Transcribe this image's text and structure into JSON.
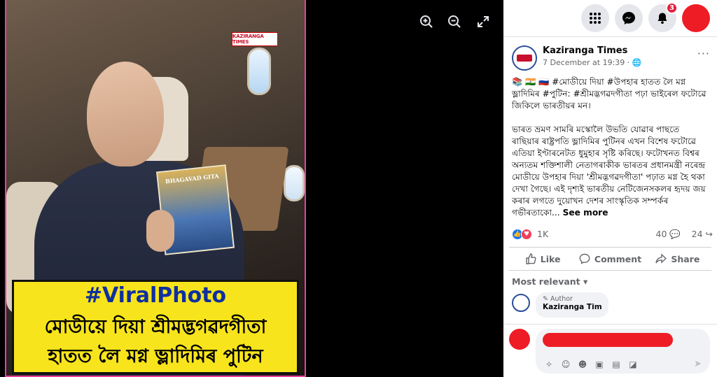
{
  "viewer": {
    "tools": [
      {
        "name": "zoom-in-icon",
        "glyph": "⊕"
      },
      {
        "name": "zoom-out-icon",
        "glyph": "⊖"
      },
      {
        "name": "fullscreen-icon",
        "glyph": "⤢"
      }
    ],
    "photo": {
      "watermark": "KAZIRANGA TIMES",
      "magazine_title": "BHAGAVAD GITA",
      "caption_tag": "#ViralPhoto",
      "caption_line1": "মোডীয়ে দিয়া শ্ৰীমদ্ভগৱদগীতা",
      "caption_line2": "হাতত লৈ মগ্ন ভ্লাদিমিৰ পুটিন"
    }
  },
  "topnav": {
    "notification_count": "3",
    "icons": [
      "menu-grid-icon",
      "messenger-icon",
      "bell-icon",
      "profile-avatar"
    ]
  },
  "post": {
    "page_name": "Kaziranga Times",
    "time": "7 December at 19:39 · 🌐",
    "more": "···",
    "text_p1": "📚 🇮🇳 🇷🇺 #মোডীয়ে দিয়া #উপহাৰ হাতত লৈ মগ্ন ভ্লাদিমিৰ #পুটিন: #শ্ৰীমদ্ভগৱদগীতা পঢ়া ভাইৰেল ফটোৱে জিকিলে ভাৰতীয়ৰ মন।",
    "text_p2": "ভাৰত ভ্ৰমণ সামৰি মস্কোলৈ উভতি যোৱাৰ পাছতে ৰাছিয়াৰ ৰাষ্ট্ৰপতি ভ্লাদিমিৰ পুটিনৰ এখন বিশেষ ফটোৱে এতিয়া ইণ্টাৰনেটত ধুমুহাৰ সৃষ্টি কৰিছে। ফটোখনত বিশ্বৰ অন্যতম শক্তিশালী নেতাগৰাকীক ভাৰতৰ প্ৰধানমন্ত্ৰী নৰেন্দ্ৰ মোডীয়ে উপহাৰ দিয়া 'শ্ৰীমদ্ভগৱদগীতা' পঢ়াত মগ্ন হৈ থকা দেখা গৈছে। এই দৃশ্যই ভাৰতীয় নেটিজেনসকলৰ হৃদয় জয় কৰাৰ লগতে দুয়োখন দেশৰ সাংস্কৃতিক সম্পৰ্কৰ গভীৰতাকো...",
    "see_more": "See more",
    "reaction_count": "1K",
    "comment_count": "40",
    "share_count": "24",
    "actions": {
      "like": "Like",
      "comment": "Comment",
      "share": "Share"
    },
    "sort_label": "Most relevant ▾",
    "comment": {
      "author_tag": "Author",
      "name": "Kaziranga Times"
    }
  },
  "composer": {
    "tool_icons": [
      "sticker-icon",
      "avatar-sticker-icon",
      "emoji-icon",
      "camera-icon",
      "gif-icon",
      "sticker-face-icon"
    ]
  },
  "colors": {
    "accent": "#1877f2",
    "redact": "#ee1c25",
    "caption_bg": "#f7e41c"
  }
}
